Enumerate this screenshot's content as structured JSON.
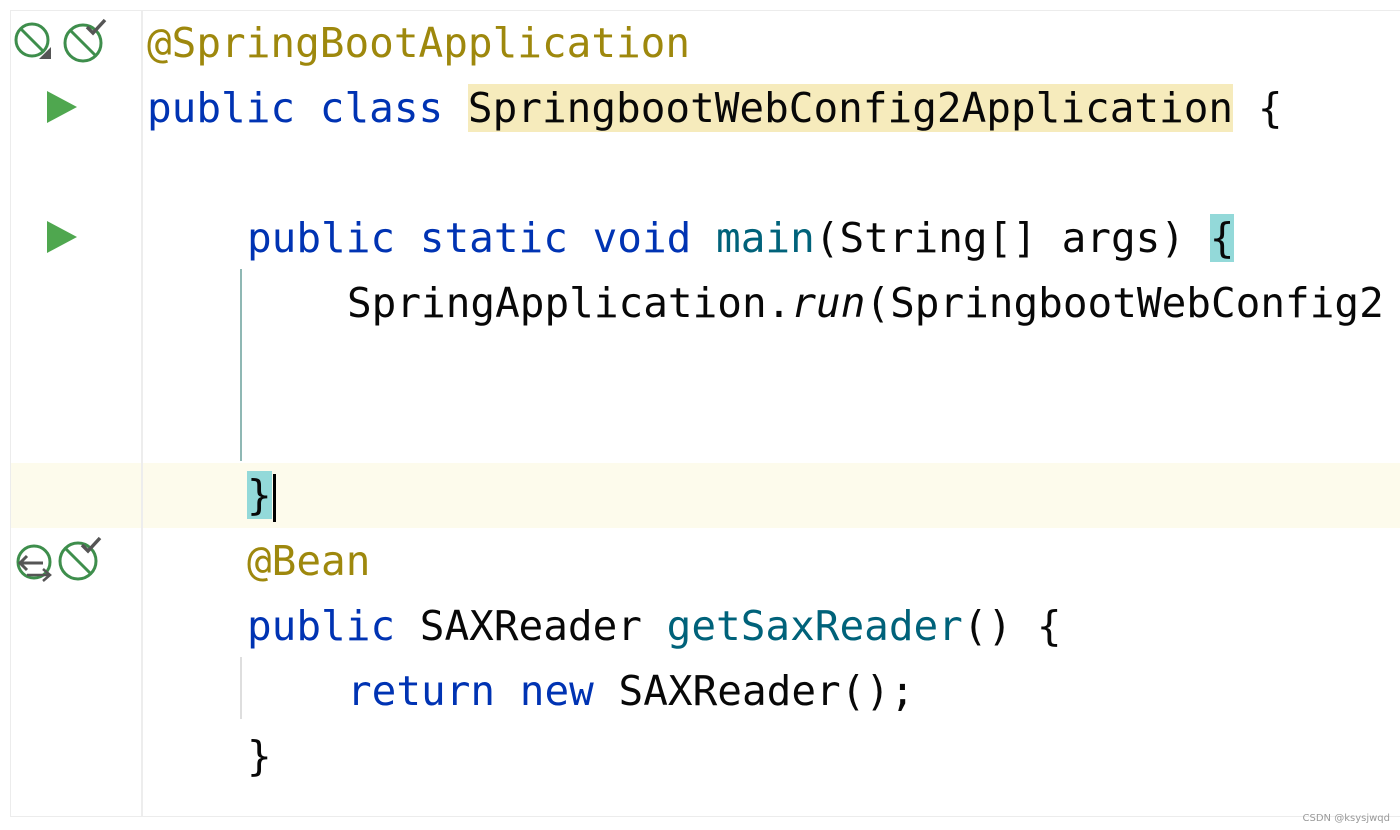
{
  "editor": {
    "lines": [
      {
        "annotation": "@SpringBootApplication"
      },
      {
        "kw_public": "public",
        "kw_class": "class",
        "class_name": "SpringbootWebConfig2Application",
        "brace": "{"
      },
      {},
      {
        "kw_public": "public",
        "kw_static": "static",
        "kw_void": "void",
        "method": "main",
        "params": "(String[] args)",
        "brace": "{"
      },
      {
        "receiver": "SpringApplication.",
        "call": "run",
        "args": "(SpringbootWebConfig2"
      },
      {},
      {},
      {
        "brace": "}"
      },
      {
        "annotation": "@Bean"
      },
      {
        "kw_public": "public",
        "type": "SAXReader",
        "method": "getSaxReader",
        "tail": "() {"
      },
      {
        "kw_return": "return",
        "kw_new": "new",
        "expr": "SAXReader();"
      },
      {
        "brace": "}"
      }
    ],
    "highlights": {
      "identifier_color": "#f6ebbc",
      "brace_match_color": "#93d9d9",
      "current_line_color": "#fdfbec"
    },
    "gutter_icons": [
      "no-beans-icon",
      "bean-check-icon",
      "run-icon",
      "run-icon",
      "navigate-bean-icon",
      "bean-check-icon"
    ],
    "colors": {
      "keyword": "#0033b3",
      "annotation": "#9e880d",
      "method": "#00627a",
      "run_icon": "#4fa74f"
    }
  },
  "watermark": "CSDN @ksysjwqd"
}
